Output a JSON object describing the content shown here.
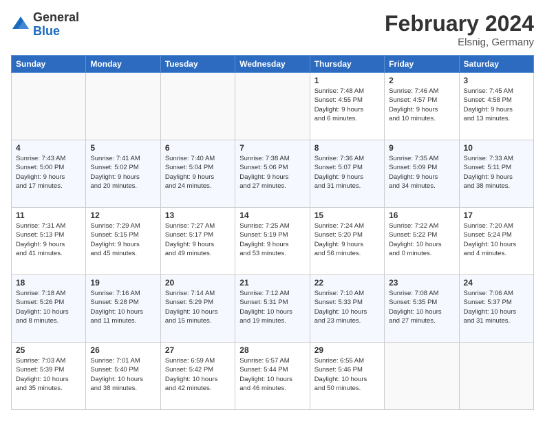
{
  "header": {
    "logo_general": "General",
    "logo_blue": "Blue",
    "month_title": "February 2024",
    "location": "Elsnig, Germany"
  },
  "calendar": {
    "days_of_week": [
      "Sunday",
      "Monday",
      "Tuesday",
      "Wednesday",
      "Thursday",
      "Friday",
      "Saturday"
    ],
    "weeks": [
      [
        {
          "day": "",
          "info": ""
        },
        {
          "day": "",
          "info": ""
        },
        {
          "day": "",
          "info": ""
        },
        {
          "day": "",
          "info": ""
        },
        {
          "day": "1",
          "info": "Sunrise: 7:48 AM\nSunset: 4:55 PM\nDaylight: 9 hours\nand 6 minutes."
        },
        {
          "day": "2",
          "info": "Sunrise: 7:46 AM\nSunset: 4:57 PM\nDaylight: 9 hours\nand 10 minutes."
        },
        {
          "day": "3",
          "info": "Sunrise: 7:45 AM\nSunset: 4:58 PM\nDaylight: 9 hours\nand 13 minutes."
        }
      ],
      [
        {
          "day": "4",
          "info": "Sunrise: 7:43 AM\nSunset: 5:00 PM\nDaylight: 9 hours\nand 17 minutes."
        },
        {
          "day": "5",
          "info": "Sunrise: 7:41 AM\nSunset: 5:02 PM\nDaylight: 9 hours\nand 20 minutes."
        },
        {
          "day": "6",
          "info": "Sunrise: 7:40 AM\nSunset: 5:04 PM\nDaylight: 9 hours\nand 24 minutes."
        },
        {
          "day": "7",
          "info": "Sunrise: 7:38 AM\nSunset: 5:06 PM\nDaylight: 9 hours\nand 27 minutes."
        },
        {
          "day": "8",
          "info": "Sunrise: 7:36 AM\nSunset: 5:07 PM\nDaylight: 9 hours\nand 31 minutes."
        },
        {
          "day": "9",
          "info": "Sunrise: 7:35 AM\nSunset: 5:09 PM\nDaylight: 9 hours\nand 34 minutes."
        },
        {
          "day": "10",
          "info": "Sunrise: 7:33 AM\nSunset: 5:11 PM\nDaylight: 9 hours\nand 38 minutes."
        }
      ],
      [
        {
          "day": "11",
          "info": "Sunrise: 7:31 AM\nSunset: 5:13 PM\nDaylight: 9 hours\nand 41 minutes."
        },
        {
          "day": "12",
          "info": "Sunrise: 7:29 AM\nSunset: 5:15 PM\nDaylight: 9 hours\nand 45 minutes."
        },
        {
          "day": "13",
          "info": "Sunrise: 7:27 AM\nSunset: 5:17 PM\nDaylight: 9 hours\nand 49 minutes."
        },
        {
          "day": "14",
          "info": "Sunrise: 7:25 AM\nSunset: 5:19 PM\nDaylight: 9 hours\nand 53 minutes."
        },
        {
          "day": "15",
          "info": "Sunrise: 7:24 AM\nSunset: 5:20 PM\nDaylight: 9 hours\nand 56 minutes."
        },
        {
          "day": "16",
          "info": "Sunrise: 7:22 AM\nSunset: 5:22 PM\nDaylight: 10 hours\nand 0 minutes."
        },
        {
          "day": "17",
          "info": "Sunrise: 7:20 AM\nSunset: 5:24 PM\nDaylight: 10 hours\nand 4 minutes."
        }
      ],
      [
        {
          "day": "18",
          "info": "Sunrise: 7:18 AM\nSunset: 5:26 PM\nDaylight: 10 hours\nand 8 minutes."
        },
        {
          "day": "19",
          "info": "Sunrise: 7:16 AM\nSunset: 5:28 PM\nDaylight: 10 hours\nand 11 minutes."
        },
        {
          "day": "20",
          "info": "Sunrise: 7:14 AM\nSunset: 5:29 PM\nDaylight: 10 hours\nand 15 minutes."
        },
        {
          "day": "21",
          "info": "Sunrise: 7:12 AM\nSunset: 5:31 PM\nDaylight: 10 hours\nand 19 minutes."
        },
        {
          "day": "22",
          "info": "Sunrise: 7:10 AM\nSunset: 5:33 PM\nDaylight: 10 hours\nand 23 minutes."
        },
        {
          "day": "23",
          "info": "Sunrise: 7:08 AM\nSunset: 5:35 PM\nDaylight: 10 hours\nand 27 minutes."
        },
        {
          "day": "24",
          "info": "Sunrise: 7:06 AM\nSunset: 5:37 PM\nDaylight: 10 hours\nand 31 minutes."
        }
      ],
      [
        {
          "day": "25",
          "info": "Sunrise: 7:03 AM\nSunset: 5:39 PM\nDaylight: 10 hours\nand 35 minutes."
        },
        {
          "day": "26",
          "info": "Sunrise: 7:01 AM\nSunset: 5:40 PM\nDaylight: 10 hours\nand 38 minutes."
        },
        {
          "day": "27",
          "info": "Sunrise: 6:59 AM\nSunset: 5:42 PM\nDaylight: 10 hours\nand 42 minutes."
        },
        {
          "day": "28",
          "info": "Sunrise: 6:57 AM\nSunset: 5:44 PM\nDaylight: 10 hours\nand 46 minutes."
        },
        {
          "day": "29",
          "info": "Sunrise: 6:55 AM\nSunset: 5:46 PM\nDaylight: 10 hours\nand 50 minutes."
        },
        {
          "day": "",
          "info": ""
        },
        {
          "day": "",
          "info": ""
        }
      ]
    ]
  }
}
